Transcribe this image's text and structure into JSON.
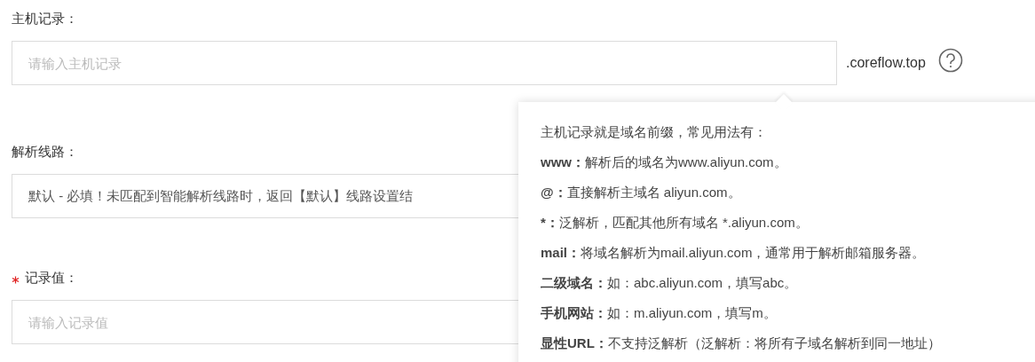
{
  "fields": [
    {
      "label": "主机记录：",
      "required": false,
      "placeholder": "请输入主机记录",
      "suffix": ".coreflow.top"
    },
    {
      "label": "解析线路：",
      "required": false,
      "value": "默认 - 必填！未匹配到智能解析线路时，返回【默认】线路设置结"
    },
    {
      "label": "记录值：",
      "required": true,
      "placeholder": "请输入记录值"
    }
  ],
  "help_popover": {
    "lines": [
      "主机记录就是域名前缀，常见用法有：",
      "**www：**解析后的域名为www.aliyun.com。",
      "**@：**直接解析主域名 aliyun.com。",
      "***：**泛解析，匹配其他所有域名 *.aliyun.com。",
      "**mail：**将域名解析为mail.aliyun.com，通常用于解析邮箱服务器。",
      "**二级域名：**如：abc.aliyun.com，填写abc。",
      "**手机网站：**如：m.aliyun.com，填写m。",
      "**显性URL：**不支持泛解析（泛解析：将所有子域名解析到同一地址）"
    ]
  }
}
